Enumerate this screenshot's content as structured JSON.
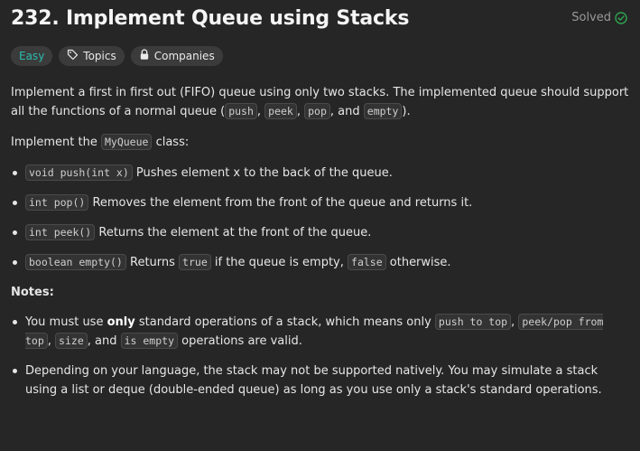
{
  "problem": {
    "title": "232. Implement Queue using Stacks",
    "status": "Solved",
    "difficulty": "Easy",
    "topics_label": "Topics",
    "companies_label": "Companies",
    "colors": {
      "background": "#262626",
      "easy": "#2cbbad",
      "solved_check": "#2ea44f"
    }
  },
  "description": {
    "intro": {
      "t1": "Implement a first in first out (FIFO) queue using only two stacks. The implemented queue should support all the functions of a normal queue (",
      "c1": "push",
      "t2": ", ",
      "c2": "peek",
      "t3": ", ",
      "c3": "pop",
      "t4": ", and ",
      "c4": "empty",
      "t5": ")."
    },
    "impl": {
      "t1": "Implement the ",
      "c1": "MyQueue",
      "t2": " class:"
    },
    "methods": [
      {
        "code": "void push(int x)",
        "text": " Pushes element x to the back of the queue."
      },
      {
        "code": "int pop()",
        "text": " Removes the element from the front of the queue and returns it."
      },
      {
        "code": "int peek()",
        "text": " Returns the element at the front of the queue."
      },
      {
        "code": "boolean empty()",
        "t1": " Returns ",
        "c2": "true",
        "t2": " if the queue is empty, ",
        "c3": "false",
        "t3": " otherwise."
      }
    ],
    "notes_title": "Notes:",
    "notes": [
      {
        "t1": "You must use ",
        "b1": "only",
        "t2": " standard operations of a stack, which means only ",
        "c1": "push to top",
        "t3": ", ",
        "c2": "peek/pop from top",
        "t4": ", ",
        "c3": "size",
        "t5": ", and ",
        "c4": "is empty",
        "t6": " operations are valid."
      },
      {
        "t1": "Depending on your language, the stack may not be supported natively. You may simulate a stack using a list or deque (double-ended queue) as long as you use only a stack's standard operations."
      }
    ]
  }
}
